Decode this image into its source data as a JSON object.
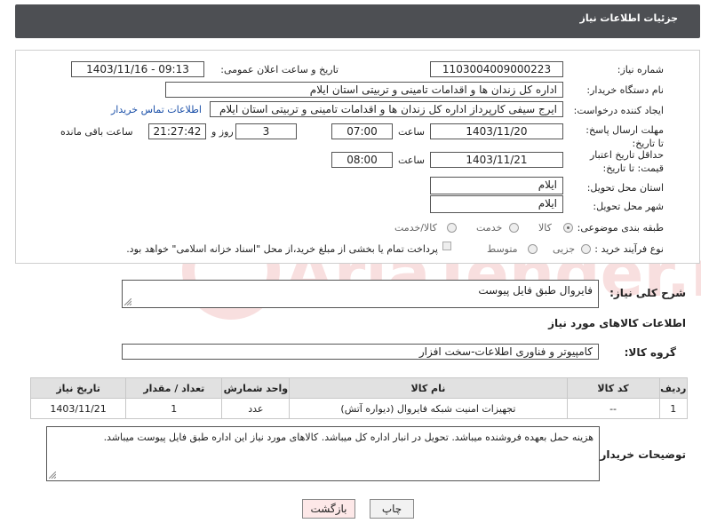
{
  "header": {
    "title": "جزئیات اطلاعات نیاز"
  },
  "form": {
    "need_number_label": "شماره نیاز:",
    "need_number": "1103004009000223",
    "announce_label": "تاریخ و ساعت اعلان عمومی:",
    "announce_value": "1403/11/16 - 09:13",
    "buyer_org_label": "نام دستگاه خریدار:",
    "buyer_org": "اداره کل زندان ها و اقدامات تامینی و تربیتی استان ایلام",
    "creator_label": "ایجاد کننده درخواست:",
    "creator": "ایرج  سیفی کارپرداز اداره کل زندان ها و اقدامات تامینی و تربیتی استان ایلام",
    "contact_link": "اطلاعات تماس خریدار",
    "reply_deadline_label": "مهلت ارسال پاسخ: تا تاریخ:",
    "reply_date": "1403/11/20",
    "time_label": "ساعت",
    "reply_time": "07:00",
    "days_value": "3",
    "days_label": "روز و",
    "remaining_time": "21:27:42",
    "remaining_label": "ساعت باقی مانده",
    "price_validity_label": "حداقل تاریخ اعتبار قیمت: تا تاریخ:",
    "price_date": "1403/11/21",
    "price_time": "08:00",
    "province_label": "استان محل تحویل:",
    "province": "ایلام",
    "city_label": "شهر محل تحویل:",
    "city": "ایلام",
    "category_label": "طبقه بندی موضوعی:",
    "category_options": [
      "کالا",
      "خدمت",
      "کالا/خدمت"
    ],
    "process_label": "نوع فرآیند خرید :",
    "process_options": [
      "جزیی",
      "متوسط"
    ],
    "payment_note": "پرداخت تمام یا بخشی از مبلغ خرید،از محل \"اسناد خزانه اسلامی\" خواهد بود."
  },
  "description": {
    "label": "شرح کلی نیاز:",
    "value": "فایروال طبق فایل پیوست"
  },
  "goods_info_title": "اطلاعات کالاهای مورد نیاز",
  "goods_group": {
    "label": "گروه کالا:",
    "value": "کامپیوتر و فناوری اطلاعات-سخت افزار"
  },
  "table": {
    "headers": [
      "ردیف",
      "کد کالا",
      "نام کالا",
      "واحد شمارش",
      "تعداد / مقدار",
      "تاریخ نیاز"
    ],
    "rows": [
      [
        "1",
        "--",
        "تجهیزات امنیت شبکه فایروال (دیواره آتش)",
        "عدد",
        "1",
        "1403/11/21"
      ]
    ]
  },
  "buyer_notes": {
    "label": "توضیحات خریدار:",
    "value": "هزینه حمل بعهده فروشنده میباشد. تحویل در انبار اداره کل میباشد. کالاهای مورد نیاز این اداره طبق فایل پیوست میباشد."
  },
  "buttons": {
    "print": "چاپ",
    "back": "بازگشت"
  },
  "watermark": "AriaTender.neT",
  "colors": {
    "header_bg": "#4d4f53",
    "link": "#1a4fa8",
    "back_button_bg": "#fde8e8"
  }
}
